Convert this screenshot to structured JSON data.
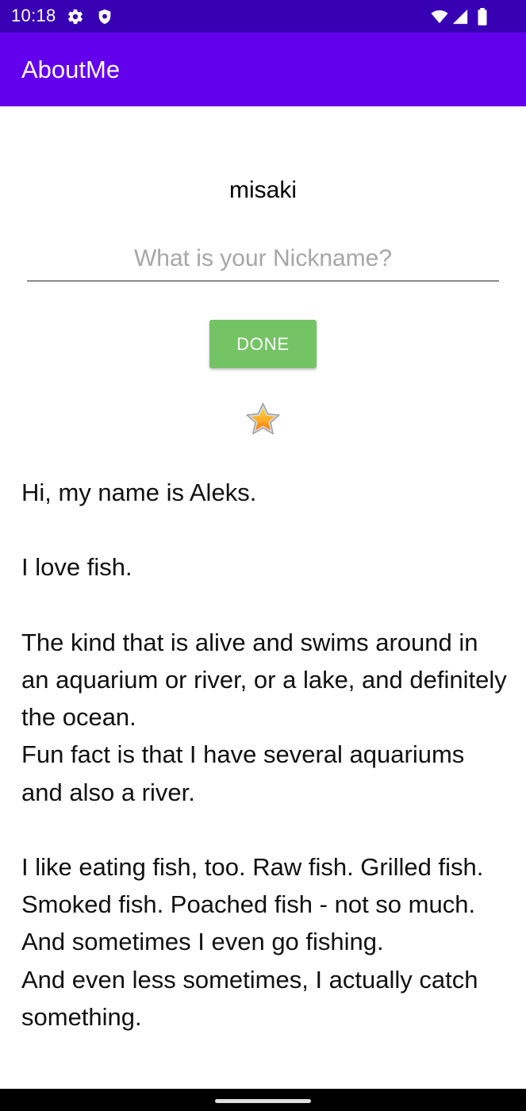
{
  "status_bar": {
    "time": "10:18",
    "left_icons": [
      "gear-icon",
      "shield-icon"
    ],
    "right_icons": [
      "wifi-icon",
      "signal-icon",
      "battery-icon"
    ],
    "color": "#3700b3"
  },
  "app_bar": {
    "title": "AboutMe",
    "color": "#6200ee"
  },
  "name": "misaki",
  "nickname_input": {
    "value": "",
    "placeholder": "What is your Nickname?"
  },
  "done_button": {
    "label": "DONE",
    "color": "#74c365"
  },
  "star": {
    "icon": "star-icon"
  },
  "bio": "Hi, my name is Aleks.\n\nI love fish.\n\nThe kind that is alive and swims around in an aquarium or river, or a lake, and definitely the ocean.\nFun fact is that I have several aquariums and also a river.\n\nI like eating fish, too. Raw fish. Grilled fish. Smoked fish. Poached fish - not so much.\nAnd sometimes I even go fishing.\nAnd even less sometimes, I actually catch something."
}
